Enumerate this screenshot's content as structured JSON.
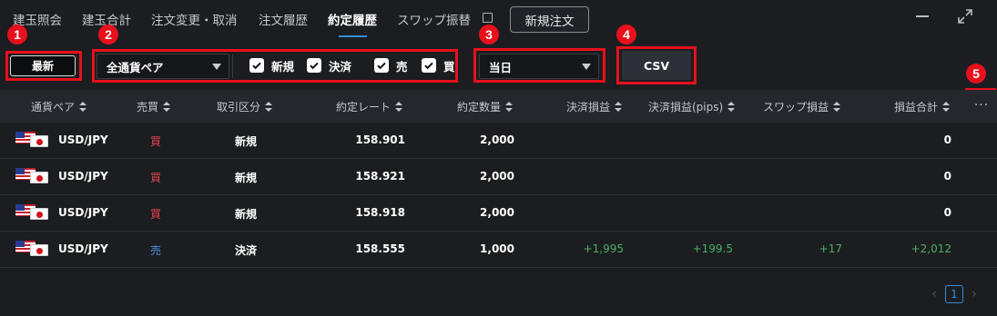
{
  "tabs": [
    {
      "label": "建玉照会"
    },
    {
      "label": "建玉合計"
    },
    {
      "label": "注文変更・取消"
    },
    {
      "label": "注文履歴"
    },
    {
      "label": "約定履歴",
      "active": true
    },
    {
      "label": "スワップ振替"
    }
  ],
  "header": {
    "new_order_label": "新規注文"
  },
  "toolbar": {
    "refresh_label": "最新",
    "pair_select_value": "全通貨ペア",
    "checkboxes": [
      {
        "label": "新規",
        "checked": true
      },
      {
        "label": "決済",
        "checked": true
      },
      {
        "label": "売",
        "checked": true
      },
      {
        "label": "買",
        "checked": true
      }
    ],
    "period_select_value": "当日",
    "csv_label": "CSV"
  },
  "annotations": [
    "1",
    "2",
    "3",
    "4",
    "5"
  ],
  "table": {
    "columns": [
      "通貨ペア",
      "売買",
      "取引区分",
      "約定レート",
      "約定数量",
      "決済損益",
      "決済損益(pips)",
      "スワップ損益",
      "損益合計"
    ],
    "more_label": "···",
    "rows": [
      {
        "pair": "USD/JPY",
        "side": "買",
        "type": "新規",
        "rate": "158.901",
        "qty": "2,000",
        "pl": "",
        "pips": "",
        "swap": "",
        "total": "0"
      },
      {
        "pair": "USD/JPY",
        "side": "買",
        "type": "新規",
        "rate": "158.921",
        "qty": "2,000",
        "pl": "",
        "pips": "",
        "swap": "",
        "total": "0"
      },
      {
        "pair": "USD/JPY",
        "side": "買",
        "type": "新規",
        "rate": "158.918",
        "qty": "2,000",
        "pl": "",
        "pips": "",
        "swap": "",
        "total": "0"
      },
      {
        "pair": "USD/JPY",
        "side": "売",
        "type": "決済",
        "rate": "158.555",
        "qty": "1,000",
        "pl": "+1,995",
        "pips": "+199.5",
        "swap": "+17",
        "total": "+2,012"
      }
    ]
  },
  "pager": {
    "prev": "‹",
    "current": "1",
    "next": "›"
  },
  "colors": {
    "annotation_red": "#e8101c",
    "buy": "#e0434b",
    "sell": "#4b8fe0",
    "profit": "#4caf61",
    "accent": "#2f8fd8"
  }
}
